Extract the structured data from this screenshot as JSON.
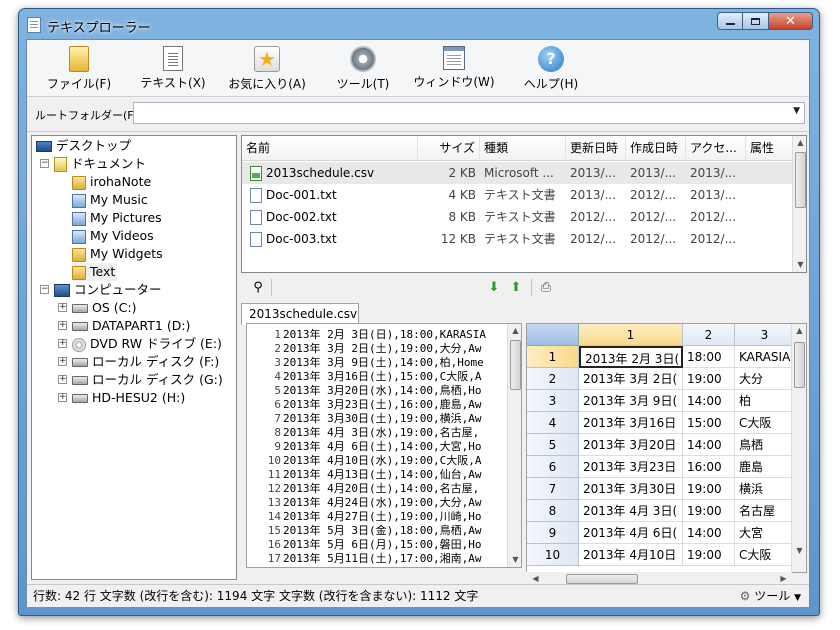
{
  "window": {
    "title": "テキスプローラー"
  },
  "menu": [
    {
      "label": "ファイル(F)",
      "icon": "folder-icon"
    },
    {
      "label": "テキスト(X)",
      "icon": "document-icon"
    },
    {
      "label": "お気に入り(A)",
      "icon": "star-icon"
    },
    {
      "label": "ツール(T)",
      "icon": "gear-icon"
    },
    {
      "label": "ウィンドウ(W)",
      "icon": "window-icon"
    },
    {
      "label": "ヘルプ(H)",
      "icon": "help-icon"
    }
  ],
  "root_folder": {
    "label": "ルートフォルダー(F):",
    "value": ""
  },
  "tree": {
    "desktop": "デスクトップ",
    "documents": "ドキュメント",
    "doc_children": [
      "irohaNote",
      "My Music",
      "My Pictures",
      "My Videos",
      "My Widgets",
      "Text"
    ],
    "computer": "コンピューター",
    "drives": [
      "OS (C:)",
      "DATAPART1 (D:)",
      "DVD RW ドライブ (E:)",
      "ローカル ディスク (F:)",
      "ローカル ディスク (G:)",
      "HD-HESU2 (H:)"
    ]
  },
  "file_list": {
    "columns": [
      "名前",
      "サイズ",
      "種類",
      "更新日時",
      "作成日時",
      "アクセ...",
      "属性"
    ],
    "rows": [
      [
        "2013schedule.csv",
        "2 KB",
        "Microsoft ...",
        "2013/...",
        "2013/...",
        "2013/...",
        ""
      ],
      [
        "Doc-001.txt",
        "4 KB",
        "テキスト文書",
        "2013/...",
        "2012/...",
        "2013/...",
        ""
      ],
      [
        "Doc-002.txt",
        "8 KB",
        "テキスト文書",
        "2012/...",
        "2012/...",
        "2012/...",
        ""
      ],
      [
        "Doc-003.txt",
        "12 KB",
        "テキスト文書",
        "2012/...",
        "2012/...",
        "2012/...",
        ""
      ]
    ]
  },
  "editor": {
    "tab": "2013schedule.csv",
    "lines": [
      "2013年 2月 3日(日),18:00,KARASIA",
      "2013年 3月 2日(土),19:00,大分,Aw",
      "2013年 3月 9日(土),14:00,柏,Home",
      "2013年 3月16日(土),15:00,C大阪,A",
      "2013年 3月20日(水),14:00,鳥栖,Ho",
      "2013年 3月23日(土),16:00,鹿島,Aw",
      "2013年 3月30日(土),19:00,横浜,Aw",
      "2013年 4月 3日(水),19:00,名古屋,",
      "2013年 4月 6日(土),14:00,大宮,Ho",
      "2013年 4月10日(水),19:00,C大阪,A",
      "2013年 4月13日(土),14:00,仙台,Aw",
      "2013年 4月20日(土),14:00,名古屋,",
      "2013年 4月24日(水),19:00,大分,Aw",
      "2013年 4月27日(土),19:00,川崎,Ho",
      "2013年 5月 3日(金),18:00,鳥栖,Aw",
      "2013年 5月 6日(月),15:00,磐田,Ho",
      "2013年 5月11日(土),17:00,湘南,Aw"
    ]
  },
  "grid": {
    "col_headers": [
      "1",
      "2",
      "3"
    ],
    "rows": [
      [
        "2013年 2月 3日(",
        "18:00",
        "KARASIA"
      ],
      [
        "2013年 3月 2日(",
        "19:00",
        "大分"
      ],
      [
        "2013年 3月 9日(",
        "14:00",
        "柏"
      ],
      [
        "2013年 3月16日",
        "15:00",
        "C大阪"
      ],
      [
        "2013年 3月20日",
        "14:00",
        "鳥栖"
      ],
      [
        "2013年 3月23日",
        "16:00",
        "鹿島"
      ],
      [
        "2013年 3月30日",
        "19:00",
        "横浜"
      ],
      [
        "2013年 4月 3日(",
        "19:00",
        "名古屋"
      ],
      [
        "2013年 4月 6日(",
        "14:00",
        "大宮"
      ],
      [
        "2013年 4月10日",
        "19:00",
        "C大阪"
      ]
    ]
  },
  "status": {
    "text": "行数: 42 行  文字数 (改行を含む): 1194 文字  文字数 (改行を含まない): 1112 文字",
    "tool_label": "ツール"
  }
}
